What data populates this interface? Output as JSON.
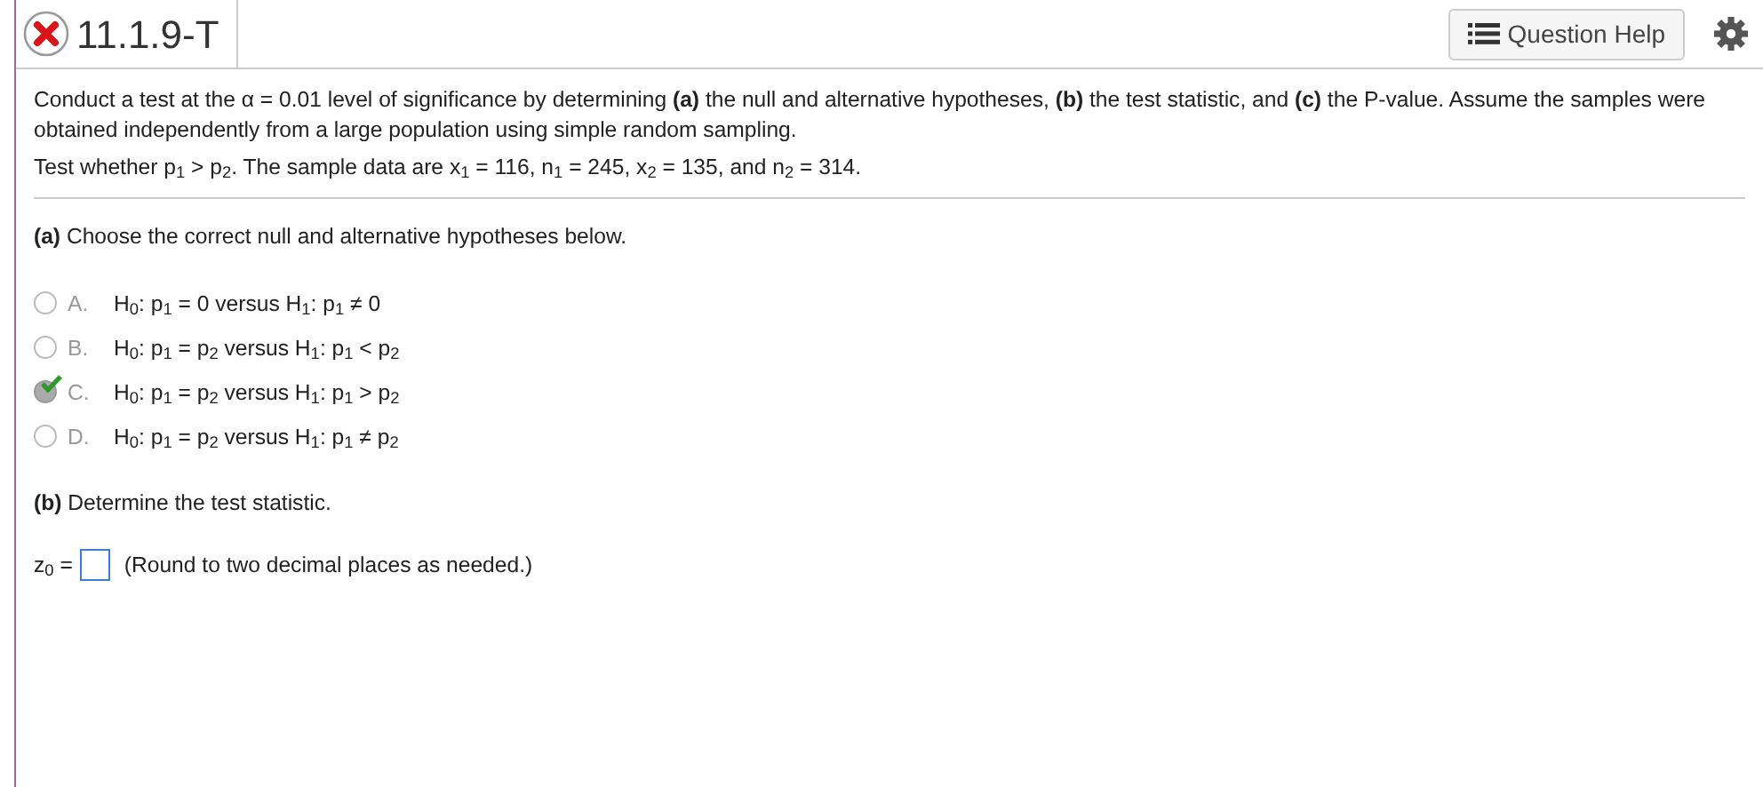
{
  "header": {
    "title": "11.1.9-T",
    "help_button": "Question Help"
  },
  "intro": [
    "Conduct a test at the α = 0.01 level of significance by determining **(a)** the null and alternative hypotheses, **(b)** the test statistic, and **(c)** the P-value. Assume the samples were obtained independently from a large population using simple random sampling.",
    "Test whether p$_{1}$ > p$_{2}$. The sample data are x$_{1}$ = 116, n$_{1}$ = 245, x$_{2}$ = 135, and n$_{2}$ = 314."
  ],
  "part_a": {
    "prompt": "**(a)** Choose the correct null and alternative hypotheses below.",
    "options": [
      {
        "letter": "A.",
        "text": "H$_{0}$: p$_{1}$ = 0 versus H$_{1}$: p$_{1}$ ≠ 0",
        "selected": false,
        "correct": false
      },
      {
        "letter": "B.",
        "text": "H$_{0}$: p$_{1}$ = p$_{2}$ versus H$_{1}$: p$_{1}$ < p$_{2}$",
        "selected": false,
        "correct": false
      },
      {
        "letter": "C.",
        "text": "H$_{0}$: p$_{1}$ = p$_{2}$ versus H$_{1}$: p$_{1}$ > p$_{2}$",
        "selected": true,
        "correct": true
      },
      {
        "letter": "D.",
        "text": "H$_{0}$: p$_{1}$ = p$_{2}$ versus H$_{1}$: p$_{1}$ ≠ p$_{2}$",
        "selected": false,
        "correct": false
      }
    ]
  },
  "part_b": {
    "prompt": "**(b)** Determine the test statistic.",
    "label": "z$_{0}$ =",
    "hint": "(Round to two decimal places as needed.)"
  }
}
